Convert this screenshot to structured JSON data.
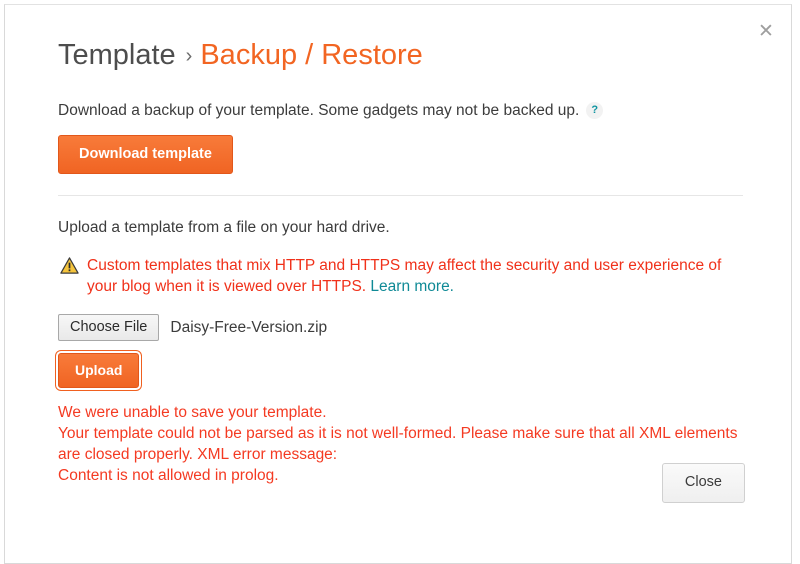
{
  "dialog": {
    "close_icon": "close-icon",
    "close_glyph": "✕"
  },
  "title": {
    "root": "Template",
    "separator": "›",
    "current": "Backup / Restore"
  },
  "download": {
    "description": "Download a backup of your template. Some gadgets may not be backed up.",
    "help_icon_glyph": "?",
    "help_icon_name": "help-icon",
    "button_label": "Download template"
  },
  "upload": {
    "description": "Upload a template from a file on your hard drive.",
    "warning_icon_name": "warning-triangle-icon",
    "warning_text": "Custom templates that mix HTTP and HTTPS may affect the security and user experience of your blog when it is viewed over HTTPS. ",
    "learn_more_label": "Learn more.",
    "choose_file_label": "Choose File",
    "selected_file_name": "Daisy-Free-Version.zip",
    "button_label": "Upload"
  },
  "error": {
    "lines": [
      "We were unable to save your template.",
      "Your template could not be parsed as it is not well-formed. Please make sure that all XML elements are closed properly. XML error message:",
      "Content is not allowed in prolog."
    ]
  },
  "footer": {
    "close_label": "Close"
  },
  "colors": {
    "accent_orange": "#f26522",
    "button_orange": "#f4712e",
    "error_red": "#f43a22",
    "warning_red": "#f0311a",
    "link_teal": "#0f8a96",
    "text_gray": "#3c3c3c"
  }
}
